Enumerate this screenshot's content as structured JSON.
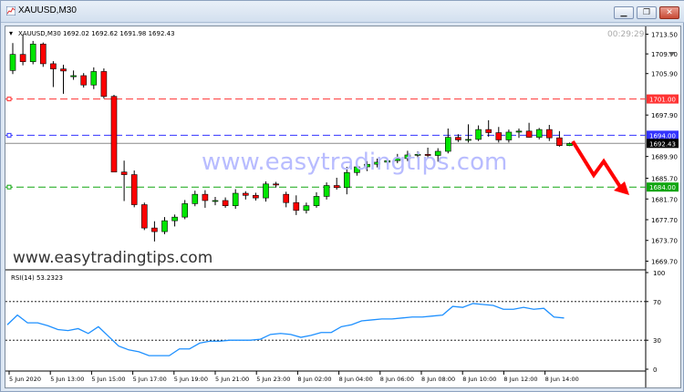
{
  "window": {
    "title": "XAUUSD,M30",
    "minimize_glyph": "▁",
    "restore_glyph": "❐",
    "close_glyph": "✕"
  },
  "chart_header": {
    "arrow_glyph": "▾",
    "label": "XAUUSD,M30  1692.02 1692.62 1691.98 1692.43",
    "timer": "00:29:29"
  },
  "watermark": "www.easytradingtips.com",
  "site_label": "www.easytradingtips.com",
  "rsi_label": "RSI(14) 53.2323",
  "colors": {
    "bull": "#00e600",
    "bear": "#ff0000",
    "resistance": "#ff3333",
    "pivot": "#3333ff",
    "support": "#11a611",
    "rsi_line": "#1e90ff",
    "watermark": "#b8bcff",
    "arrow": "#ff0000"
  },
  "chart_data": {
    "type": "candlestick",
    "price_axis": {
      "ticks": [
        "1713.50",
        "1709.70",
        "1705.90",
        "1697.90",
        "1689.90",
        "1685.70",
        "1681.70",
        "1677.70",
        "1673.70",
        "1669.70"
      ],
      "ylim": [
        1668.2,
        1715.0
      ]
    },
    "time_axis": {
      "ticks": [
        "5 Jun 2020",
        "5 Jun 13:00",
        "5 Jun 15:00",
        "5 Jun 17:00",
        "5 Jun 19:00",
        "5 Jun 21:00",
        "5 Jun 23:00",
        "8 Jun 02:00",
        "8 Jun 04:00",
        "8 Jun 06:00",
        "8 Jun 08:00",
        "8 Jun 10:00",
        "8 Jun 12:00",
        "8 Jun 14:00"
      ]
    },
    "levels": [
      {
        "name": "resistance",
        "price": 1701.0,
        "label": "1701.00"
      },
      {
        "name": "pivot",
        "price": 1694.0,
        "label": "1694.00"
      },
      {
        "name": "support",
        "price": 1684.0,
        "label": "1684.00"
      }
    ],
    "current_price": {
      "price": 1692.43,
      "label": "1692.43"
    },
    "candles": [
      [
        1706.5,
        1711.8,
        1705.8,
        1709.6
      ],
      [
        1709.6,
        1713.4,
        1707.5,
        1708.2
      ],
      [
        1708.2,
        1712.2,
        1707.7,
        1711.6
      ],
      [
        1711.6,
        1711.9,
        1707.2,
        1707.8
      ],
      [
        1707.8,
        1708.3,
        1703.3,
        1706.8
      ],
      [
        1706.8,
        1707.6,
        1702.0,
        1706.4
      ],
      [
        1705.3,
        1706.5,
        1704.7,
        1705.5
      ],
      [
        1705.5,
        1706.0,
        1703.2,
        1703.7
      ],
      [
        1703.7,
        1707.1,
        1702.9,
        1706.3
      ],
      [
        1706.3,
        1706.9,
        1701.1,
        1701.5
      ],
      [
        1701.5,
        1701.8,
        1686.9,
        1686.9
      ],
      [
        1686.9,
        1689.1,
        1681.3,
        1686.4
      ],
      [
        1686.4,
        1687.2,
        1680.1,
        1680.6
      ],
      [
        1680.6,
        1681.0,
        1675.7,
        1676.1
      ],
      [
        1676.1,
        1677.4,
        1673.5,
        1675.4
      ],
      [
        1675.4,
        1678.2,
        1674.9,
        1677.5
      ],
      [
        1677.5,
        1678.7,
        1676.4,
        1678.2
      ],
      [
        1678.2,
        1681.5,
        1677.8,
        1680.8
      ],
      [
        1680.8,
        1683.3,
        1680.3,
        1682.6
      ],
      [
        1682.6,
        1683.4,
        1680.0,
        1681.4
      ],
      [
        1681.4,
        1682.1,
        1680.5,
        1681.4
      ],
      [
        1681.4,
        1682.0,
        1680.0,
        1680.4
      ],
      [
        1680.4,
        1683.6,
        1679.8,
        1682.8
      ],
      [
        1682.8,
        1683.2,
        1681.6,
        1682.4
      ],
      [
        1682.4,
        1682.9,
        1681.4,
        1681.9
      ],
      [
        1681.9,
        1685.1,
        1681.2,
        1684.6
      ],
      [
        1684.6,
        1685.0,
        1683.9,
        1684.4
      ],
      [
        1682.6,
        1683.1,
        1680.1,
        1681.0
      ],
      [
        1681.0,
        1682.4,
        1678.6,
        1679.5
      ],
      [
        1679.5,
        1681.0,
        1678.9,
        1680.4
      ],
      [
        1680.4,
        1683.0,
        1680.0,
        1682.2
      ],
      [
        1682.2,
        1684.9,
        1681.6,
        1684.3
      ],
      [
        1684.3,
        1685.8,
        1683.5,
        1683.9
      ],
      [
        1683.9,
        1687.9,
        1682.6,
        1686.8
      ],
      [
        1686.8,
        1688.6,
        1686.2,
        1687.9
      ],
      [
        1687.9,
        1689.0,
        1687.1,
        1688.4
      ],
      [
        1688.4,
        1689.5,
        1687.8,
        1688.8
      ],
      [
        1688.8,
        1689.4,
        1688.2,
        1689.1
      ],
      [
        1689.1,
        1690.4,
        1688.6,
        1689.5
      ],
      [
        1689.5,
        1691.0,
        1689.0,
        1690.2
      ],
      [
        1690.2,
        1690.9,
        1689.6,
        1690.3
      ],
      [
        1690.3,
        1691.6,
        1689.7,
        1690.1
      ],
      [
        1690.1,
        1691.5,
        1688.9,
        1690.9
      ],
      [
        1690.9,
        1695.3,
        1690.5,
        1693.6
      ],
      [
        1693.6,
        1694.2,
        1692.7,
        1693.1
      ],
      [
        1693.1,
        1696.1,
        1692.6,
        1693.2
      ],
      [
        1693.2,
        1695.9,
        1692.9,
        1695.1
      ],
      [
        1695.1,
        1696.9,
        1693.7,
        1694.5
      ],
      [
        1694.5,
        1695.6,
        1692.6,
        1693.1
      ],
      [
        1693.1,
        1695.1,
        1692.6,
        1694.6
      ],
      [
        1694.6,
        1695.3,
        1693.5,
        1694.8
      ],
      [
        1694.8,
        1696.4,
        1693.5,
        1693.6
      ],
      [
        1693.6,
        1695.4,
        1693.2,
        1695.1
      ],
      [
        1695.1,
        1696.0,
        1692.9,
        1693.5
      ],
      [
        1693.5,
        1694.8,
        1691.8,
        1692.0
      ],
      [
        1692.0,
        1692.6,
        1691.9,
        1692.4
      ]
    ],
    "rsi": {
      "axis_ticks": [
        "100",
        "70",
        "30",
        "0"
      ],
      "levels": [
        70,
        30
      ],
      "ylim": [
        0,
        100
      ],
      "values": [
        46,
        56,
        48,
        48,
        45,
        41,
        40,
        42,
        37,
        44,
        34,
        24,
        20,
        18,
        14,
        14,
        14,
        21,
        21,
        27,
        29,
        29,
        30,
        30,
        30,
        31,
        36,
        37,
        36,
        33,
        35,
        38,
        38,
        44,
        46,
        50,
        51,
        52,
        52,
        53,
        54,
        54,
        55,
        56,
        65,
        64,
        68,
        67,
        66,
        62,
        62,
        64,
        62,
        63,
        54,
        53
      ]
    }
  }
}
